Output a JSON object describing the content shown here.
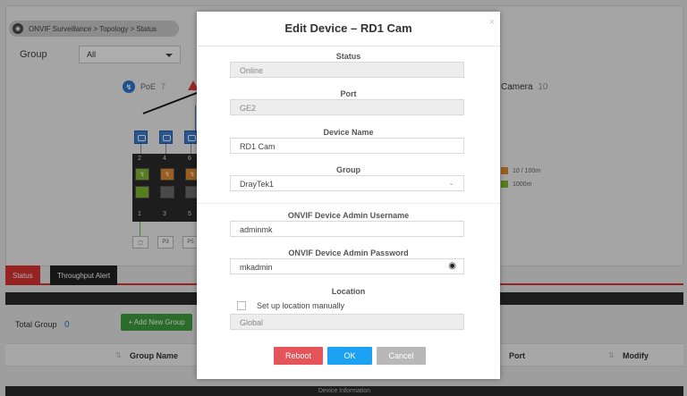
{
  "breadcrumb": {
    "text": "ONVIF Surveillance > Topology > Status"
  },
  "filter": {
    "label": "Group",
    "value": "All"
  },
  "summary": {
    "poe_label": "PoE",
    "poe_count": "7",
    "camera_label": "Camera",
    "camera_count": "10"
  },
  "switch": {
    "top_ports": [
      "2",
      "4",
      "6"
    ],
    "bottom_ports": [
      "1",
      "3",
      "5"
    ],
    "p_labels": [
      "P3",
      "P5"
    ]
  },
  "legend": [
    {
      "label": "10 / 100m",
      "color": "#e58b2b"
    },
    {
      "label": "1000m",
      "color": "#7fb82e"
    }
  ],
  "tabs": {
    "status": "Status",
    "throughput": "Throughput Alert"
  },
  "groups": {
    "total_label": "Total Group",
    "total_count": "0",
    "add_button": "+ Add New Group"
  },
  "table": {
    "col_group_name": "Group Name",
    "col_port": "Port",
    "col_modify": "Modify",
    "footer": "Device Information"
  },
  "modal": {
    "title": "Edit Device – RD1 Cam",
    "close": "×",
    "status_label": "Status",
    "status_value": "Online",
    "port_label": "Port",
    "port_value": "GE2",
    "device_name_label": "Device Name",
    "device_name_value": "RD1 Cam",
    "group_label": "Group",
    "group_value": "DrayTek1",
    "username_label": "ONVIF Device Admin Username",
    "username_value": "adminmk",
    "password_label": "ONVIF Device Admin Password",
    "password_value": "mkadmin",
    "location_label": "Location",
    "location_checkbox": "Set up location manually",
    "location_value": "Global",
    "reboot": "Reboot",
    "ok": "OK",
    "cancel": "Cancel"
  }
}
